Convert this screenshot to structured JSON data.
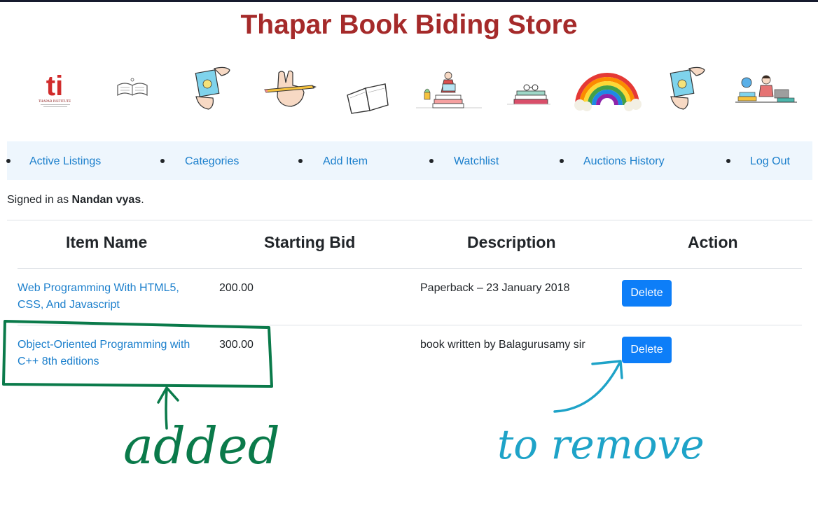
{
  "header": {
    "title": "Thapar Book Biding Store"
  },
  "illustrations": [
    {
      "icon": "thapar-logo",
      "logo_text": "ti",
      "subtitle": "THAPAR INSTITUTE"
    },
    {
      "icon": "open-book-sketch-icon"
    },
    {
      "icon": "hand-holding-paper-icon"
    },
    {
      "icon": "hand-with-pencil-icon"
    },
    {
      "icon": "open-book-icon"
    },
    {
      "icon": "reading-person-stack-icon"
    },
    {
      "icon": "book-stack-glasses-icon"
    },
    {
      "icon": "rainbow-icon"
    },
    {
      "icon": "hand-holding-paper-icon"
    },
    {
      "icon": "student-desk-icon"
    }
  ],
  "nav": {
    "items": [
      {
        "label": "Active Listings"
      },
      {
        "label": "Categories"
      },
      {
        "label": "Add Item"
      },
      {
        "label": "Watchlist"
      },
      {
        "label": "Auctions History"
      },
      {
        "label": "Log Out"
      }
    ]
  },
  "user": {
    "prefix": "Signed in as",
    "name": "Nandan vyas",
    "suffix": "."
  },
  "table": {
    "headers": [
      "Item Name",
      "Starting Bid",
      "Description",
      "Action"
    ],
    "rows": [
      {
        "name_line1": "Web Programming With HTML5,",
        "name_line2": "CSS, And Javascript",
        "bid": "200.00",
        "description": "Paperback – 23 January 2018",
        "action": "Delete"
      },
      {
        "name_line1": "Object-Oriented Programming with",
        "name_line2": "C++ 8th editions",
        "bid": "300.00",
        "description": "book written by Balagurusamy sir",
        "action": "Delete"
      }
    ]
  },
  "annotations": {
    "left": "added",
    "right": "to remove"
  },
  "colors": {
    "title": "#a52a2a",
    "link": "#1b7fcc",
    "button": "#0d7ef8",
    "navbar_bg": "#eef6fd",
    "annotation_green": "#0a7a4a",
    "annotation_blue": "#1ea3c8"
  }
}
